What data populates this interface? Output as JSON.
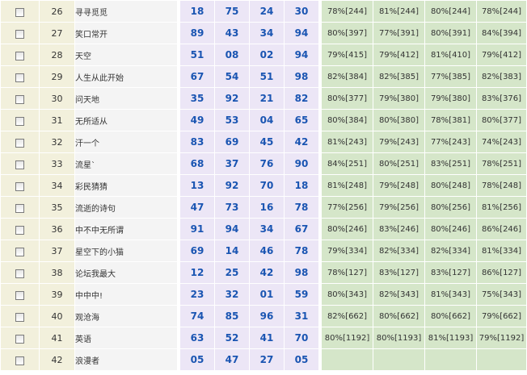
{
  "rows": [
    {
      "no": "26",
      "name": "寻寻觅觅",
      "nums": [
        "18",
        "75",
        "24",
        "30"
      ],
      "pcts": [
        "78%[244]",
        "81%[244]",
        "80%[244]",
        "78%[244]"
      ]
    },
    {
      "no": "27",
      "name": "笑口常开",
      "nums": [
        "89",
        "43",
        "34",
        "94"
      ],
      "pcts": [
        "80%[397]",
        "77%[391]",
        "80%[391]",
        "84%[394]"
      ]
    },
    {
      "no": "28",
      "name": "天空",
      "nums": [
        "51",
        "08",
        "02",
        "94"
      ],
      "pcts": [
        "79%[415]",
        "79%[412]",
        "81%[410]",
        "79%[412]"
      ]
    },
    {
      "no": "29",
      "name": "人生从此开始",
      "nums": [
        "67",
        "54",
        "51",
        "98"
      ],
      "pcts": [
        "82%[384]",
        "82%[385]",
        "77%[385]",
        "82%[383]"
      ]
    },
    {
      "no": "30",
      "name": "问天地",
      "nums": [
        "35",
        "92",
        "21",
        "82"
      ],
      "pcts": [
        "80%[377]",
        "79%[380]",
        "79%[380]",
        "83%[376]"
      ]
    },
    {
      "no": "31",
      "name": "无所适从",
      "nums": [
        "49",
        "53",
        "04",
        "65"
      ],
      "pcts": [
        "80%[384]",
        "80%[380]",
        "78%[381]",
        "80%[377]"
      ]
    },
    {
      "no": "32",
      "name": "汗一个",
      "nums": [
        "83",
        "69",
        "45",
        "42"
      ],
      "pcts": [
        "81%[243]",
        "79%[243]",
        "77%[243]",
        "74%[243]"
      ]
    },
    {
      "no": "33",
      "name": "流星`",
      "nums": [
        "68",
        "37",
        "76",
        "90"
      ],
      "pcts": [
        "84%[251]",
        "80%[251]",
        "83%[251]",
        "78%[251]"
      ]
    },
    {
      "no": "34",
      "name": "彩民猜猜",
      "nums": [
        "13",
        "92",
        "70",
        "18"
      ],
      "pcts": [
        "81%[248]",
        "79%[248]",
        "80%[248]",
        "78%[248]"
      ]
    },
    {
      "no": "35",
      "name": "流逝的诗句",
      "nums": [
        "47",
        "73",
        "16",
        "78"
      ],
      "pcts": [
        "77%[256]",
        "79%[256]",
        "80%[256]",
        "81%[256]"
      ]
    },
    {
      "no": "36",
      "name": "中不中无所谓",
      "nums": [
        "91",
        "94",
        "34",
        "67"
      ],
      "pcts": [
        "80%[246]",
        "83%[246]",
        "80%[246]",
        "86%[246]"
      ]
    },
    {
      "no": "37",
      "name": "星空下的小猫",
      "nums": [
        "69",
        "14",
        "46",
        "78"
      ],
      "pcts": [
        "79%[334]",
        "82%[334]",
        "82%[334]",
        "81%[334]"
      ]
    },
    {
      "no": "38",
      "name": "论坛我最大",
      "nums": [
        "12",
        "25",
        "42",
        "98"
      ],
      "pcts": [
        "78%[127]",
        "83%[127]",
        "83%[127]",
        "86%[127]"
      ]
    },
    {
      "no": "39",
      "name": "中中中!",
      "nums": [
        "23",
        "32",
        "01",
        "59"
      ],
      "pcts": [
        "80%[343]",
        "82%[343]",
        "81%[343]",
        "75%[343]"
      ]
    },
    {
      "no": "40",
      "name": "观沧海",
      "nums": [
        "74",
        "85",
        "96",
        "31"
      ],
      "pcts": [
        "82%[662]",
        "80%[662]",
        "80%[662]",
        "79%[662]"
      ]
    },
    {
      "no": "41",
      "name": "英语",
      "nums": [
        "63",
        "52",
        "41",
        "70"
      ],
      "pcts": [
        "80%[1192]",
        "80%[1193]",
        "81%[1193]",
        "79%[1192]"
      ]
    },
    {
      "no": "42",
      "name": "浪漫者",
      "nums": [
        "05",
        "47",
        "27",
        "05"
      ],
      "pcts": [
        "",
        "",
        "",
        ""
      ]
    }
  ]
}
